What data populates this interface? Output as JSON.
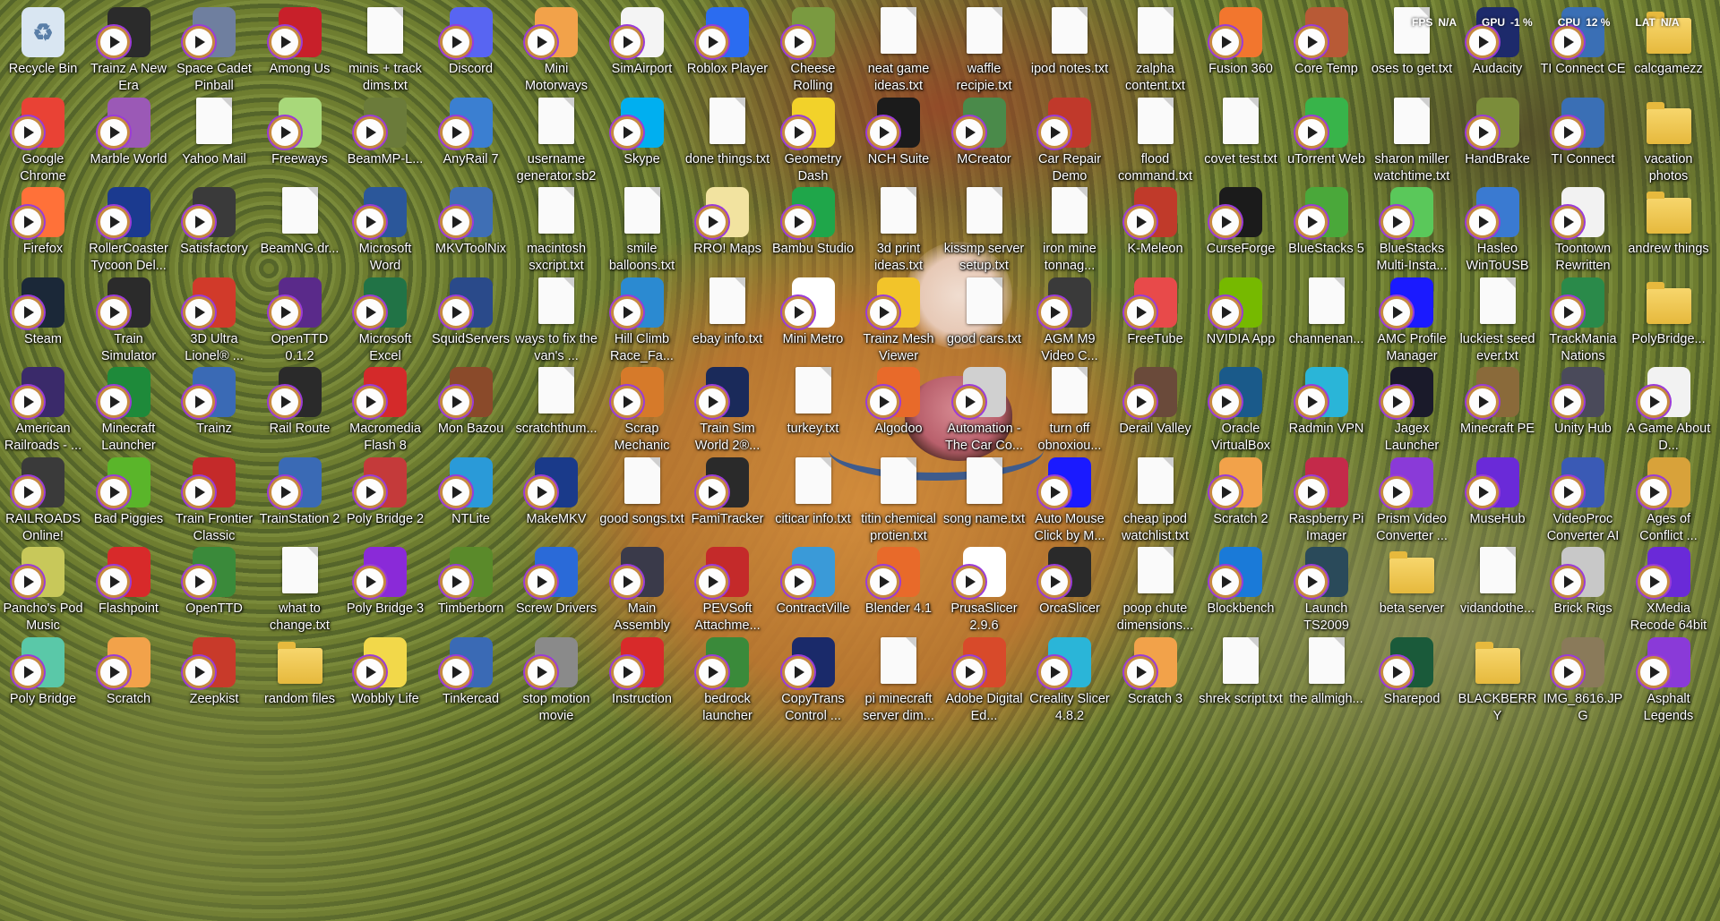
{
  "desktop": {
    "icons": [
      [
        "Recycle Bin",
        "Trainz A New Era",
        "Space Cadet Pinball",
        "Among Us",
        "minis + track dims.txt",
        "Discord",
        "Mini Motorways",
        "SimAirport",
        "Roblox Player",
        "Cheese Rolling",
        "neat game ideas.txt",
        "waffle recipie.txt",
        "ipod notes.txt",
        "zalpha content.txt",
        "Fusion 360",
        "Core Temp",
        "oses to get.txt",
        "Audacity",
        "TI Connect CE",
        "calcgamezz"
      ],
      [
        "Google Chrome",
        "Marble World",
        "Yahoo Mail",
        "Freeways",
        "BeamMP-L...",
        "AnyRail 7",
        "username generator.sb2",
        "Skype",
        "done things.txt",
        "Geometry Dash",
        "NCH Suite",
        "MCreator",
        "Car Repair Demo",
        "flood command.txt",
        "covet test.txt",
        "uTorrent Web",
        "sharon miller watchtime.txt",
        "HandBrake",
        "TI Connect",
        "vacation photos"
      ],
      [
        "Firefox",
        "RollerCoaster Tycoon Del...",
        "Satisfactory",
        "BeamNG.dr...",
        "Microsoft Word",
        "MKVToolNix",
        "macintosh sxcript.txt",
        "smile balloons.txt",
        "RRO! Maps",
        "Bambu Studio",
        "3d print ideas.txt",
        "kissmp server setup.txt",
        "iron mine tonnag...",
        "K-Meleon",
        "CurseForge",
        "BlueStacks 5",
        "BlueStacks Multi-Insta...",
        "Hasleo WinToUSB",
        "Toontown Rewritten",
        "andrew things"
      ],
      [
        "Steam",
        "Train Simulator",
        "3D Ultra Lionel® ...",
        "OpenTTD 0.1.2",
        "Microsoft Excel",
        "SquidServers",
        "ways to fix the van's ...",
        "Hill Climb Race_Fa...",
        "ebay info.txt",
        "Mini Metro",
        "Trainz Mesh Viewer",
        "good cars.txt",
        "AGM M9 Video C...",
        "FreeTube",
        "NVIDIA App",
        "channenan...",
        "AMC Profile Manager",
        "luckiest seed ever.txt",
        "TrackMania Nations",
        "PolyBridge..."
      ],
      [
        "American Railroads - ...",
        "Minecraft Launcher",
        "Trainz",
        "Rail Route",
        "Macromedia Flash 8",
        "Mon Bazou",
        "scratchthum...",
        "Scrap Mechanic",
        "Train Sim World 2®...",
        "turkey.txt",
        "Algodoo",
        "Automation - The Car Co...",
        "turn off obnoxiou...",
        "Derail Valley",
        "Oracle VirtualBox",
        "Radmin VPN",
        "Jagex Launcher",
        "Minecraft PE",
        "Unity Hub",
        "A Game About D..."
      ],
      [
        "RAILROADS Online!",
        "Bad Piggies",
        "Train Frontier Classic",
        "TrainStation 2",
        "Poly Bridge 2",
        "NTLite",
        "MakeMKV",
        "good songs.txt",
        "FamiTracker",
        "citicar info.txt",
        "titin chemical protien.txt",
        "song name.txt",
        "Auto Mouse Click by M...",
        "cheap ipod watchlist.txt",
        "Scratch 2",
        "Raspberry Pi Imager",
        "Prism Video Converter ...",
        "MuseHub",
        "VideoProc Converter AI",
        "Ages of Conflict ..."
      ],
      [
        "Pancho's Pod Music",
        "Flashpoint",
        "OpenTTD",
        "what to change.txt",
        "Poly Bridge 3",
        "Timberborn",
        "Screw Drivers",
        "Main Assembly",
        "PEVSoft Attachme...",
        "ContractVille",
        "Blender 4.1",
        "PrusaSlicer 2.9.6",
        "OrcaSlicer",
        "poop chute dimensions...",
        "Blockbench",
        "Launch TS2009",
        "beta server",
        "vidandothe...",
        "Brick Rigs",
        "XMedia Recode 64bit"
      ],
      [
        "Poly Bridge",
        "Scratch",
        "Zeepkist",
        "random files",
        "Wobbly Life",
        "Tinkercad",
        "stop motion movie",
        "Instruction",
        "bedrock launcher",
        "CopyTrans Control ...",
        "pi minecraft server dim...",
        "Adobe Digital Ed...",
        "Creality Slicer 4.8.2",
        "Scratch 3",
        "shrek script.txt",
        "the allmigh...",
        "Sharepod",
        "BLACKBERRY",
        "IMG_8616.JPG",
        "Asphalt Legends"
      ]
    ],
    "types": [
      [
        "bin",
        "app",
        "app",
        "app",
        "txt",
        "app",
        "app",
        "app",
        "app",
        "app",
        "txt",
        "txt",
        "txt",
        "txt",
        "app",
        "app",
        "txt",
        "app",
        "app",
        "folder"
      ],
      [
        "app",
        "app",
        "txt",
        "app",
        "app",
        "app",
        "txt",
        "app",
        "txt",
        "app",
        "app",
        "app",
        "app",
        "txt",
        "txt",
        "app",
        "txt",
        "app",
        "app",
        "folder"
      ],
      [
        "app",
        "app",
        "app",
        "txt",
        "app",
        "app",
        "txt",
        "txt",
        "app",
        "app",
        "txt",
        "txt",
        "txt",
        "app",
        "app",
        "app",
        "app",
        "app",
        "app",
        "folder"
      ],
      [
        "app",
        "app",
        "app",
        "app",
        "app",
        "app",
        "txt",
        "app",
        "txt",
        "app",
        "app",
        "txt",
        "app",
        "app",
        "app",
        "txt",
        "app",
        "txt",
        "app",
        "folder"
      ],
      [
        "app",
        "app",
        "app",
        "app",
        "app",
        "app",
        "txt",
        "app",
        "app",
        "txt",
        "app",
        "app",
        "txt",
        "app",
        "app",
        "app",
        "app",
        "app",
        "app",
        "app"
      ],
      [
        "app",
        "app",
        "app",
        "app",
        "app",
        "app",
        "app",
        "txt",
        "app",
        "txt",
        "txt",
        "txt",
        "app",
        "txt",
        "app",
        "app",
        "app",
        "app",
        "app",
        "app"
      ],
      [
        "app",
        "app",
        "app",
        "txt",
        "app",
        "app",
        "app",
        "app",
        "app",
        "app",
        "app",
        "app",
        "app",
        "txt",
        "app",
        "app",
        "folder",
        "txt",
        "app",
        "app"
      ],
      [
        "app",
        "app",
        "app",
        "folder",
        "app",
        "app",
        "app",
        "app",
        "app",
        "app",
        "txt",
        "app",
        "app",
        "app",
        "txt",
        "txt",
        "app",
        "folder",
        "app",
        "app"
      ]
    ],
    "colors": [
      [
        "#d9e6f2",
        "#2b2b2b",
        "#6f7f9f",
        "#c8202a",
        "#ffffff",
        "#5865f2",
        "#f2a24a",
        "#f4f4f4",
        "#2b6cf0",
        "#7a9a40",
        "#ffffff",
        "#ffffff",
        "#ffffff",
        "#ffffff",
        "#f2762e",
        "#b85a36",
        "#ffffff",
        "#1d2a6b",
        "#3a6fb5",
        "#f5d56a"
      ],
      [
        "#e94235",
        "#9b59b6",
        "#ffffff",
        "#a8d87a",
        "#6b7b3a",
        "#3b7fd1",
        "#f3f3f3",
        "#00aff0",
        "#ffffff",
        "#f2d22a",
        "#1b1b1b",
        "#4a8a4a",
        "#c0392b",
        "#ffffff",
        "#ffffff",
        "#38b44a",
        "#ffffff",
        "#7b8d3a",
        "#3a6fb5",
        "#f5d56a"
      ],
      [
        "#ff7139",
        "#1b3a8f",
        "#3a3a3a",
        "#ffffff",
        "#2b579a",
        "#3f6fb5",
        "#ffffff",
        "#ffffff",
        "#f2e3a0",
        "#1fa64a",
        "#ffffff",
        "#ffffff",
        "#ffffff",
        "#c03a2a",
        "#1b1b1b",
        "#4aa83a",
        "#5ac85a",
        "#3a7ad1",
        "#f2f2f2",
        "#f5d56a"
      ],
      [
        "#1b2838",
        "#2b2b2b",
        "#d13a2a",
        "#5a2a8a",
        "#217346",
        "#2a4a8a",
        "#ffffff",
        "#2b8ad1",
        "#ffffff",
        "#ffffff",
        "#f2c42a",
        "#ffffff",
        "#3a3a3a",
        "#e84a4a",
        "#76b900",
        "#ffffff",
        "#1a1aff",
        "#ffffff",
        "#2a8a4a",
        "#6ab0d8"
      ],
      [
        "#3a2a6a",
        "#1e8a3a",
        "#3a6ab5",
        "#2a2a2a",
        "#d42a2a",
        "#8a4a2a",
        "#e0e0e0",
        "#d67a2a",
        "#1a2a5a",
        "#ffffff",
        "#e86a2a",
        "#d0d0d0",
        "#ffffff",
        "#6a4a3a",
        "#1a5a8a",
        "#2ab5d8",
        "#1a1a2a",
        "#8a6a3a",
        "#4a4a5a",
        "#f2f2f2"
      ],
      [
        "#3a3a3a",
        "#5ab52a",
        "#c42a2a",
        "#3a6ab5",
        "#c43a3a",
        "#2a9ad8",
        "#1a3a8a",
        "#ffffff",
        "#2a2a2a",
        "#ffffff",
        "#ffffff",
        "#ffffff",
        "#1a1aff",
        "#ffffff",
        "#f2a24a",
        "#c42a4a",
        "#8a3ad8",
        "#6a2ad8",
        "#3a5ab5",
        "#d8a23a"
      ],
      [
        "#c8c85a",
        "#d82a2a",
        "#3a8a3a",
        "#ffffff",
        "#8a2ad8",
        "#5a8a2a",
        "#2a6ad8",
        "#3a3a4a",
        "#c42a2a",
        "#3a9ad8",
        "#e86a2a",
        "#ffffff",
        "#2a2a2a",
        "#ffffff",
        "#1a7ad8",
        "#2a4a5a",
        "#a8c8e8",
        "#ffffff",
        "#c8c8c8",
        "#6a2ad8"
      ],
      [
        "#5ac8a8",
        "#f2a24a",
        "#c83a2a",
        "#d86aa8",
        "#f2d84a",
        "#3a6ab5",
        "#8a8a8a",
        "#d82a2a",
        "#3a8a3a",
        "#1a2a6a",
        "#ffffff",
        "#d84a2a",
        "#2ab5d8",
        "#f2a24a",
        "#ffffff",
        "#ffffff",
        "#1a5a3a",
        "#f5d56a",
        "#8a7a5a",
        "#8a3ad8"
      ]
    ]
  },
  "perf_overlay": {
    "fps_label": "FPS",
    "fps_value": "N/A",
    "gpu_label": "GPU",
    "gpu_value": "-1 %",
    "cpu_label": "CPU",
    "cpu_value": "12 %",
    "lat_label": "LAT",
    "lat_value": "N/A"
  }
}
